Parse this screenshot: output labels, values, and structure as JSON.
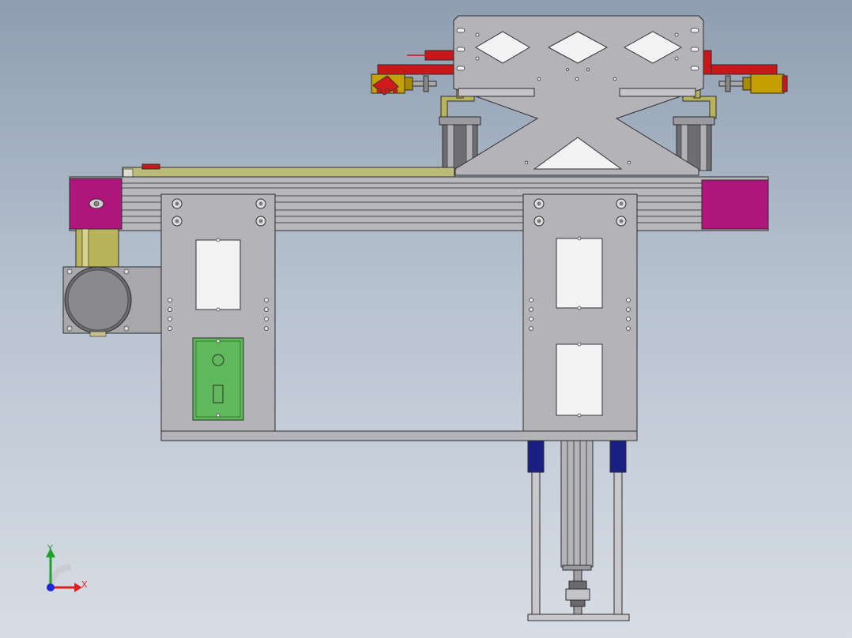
{
  "view": {
    "background_top": "#8e9db0",
    "background_bottom": "#d7dde6"
  },
  "triad": {
    "y_label": "Y",
    "x_label": "X",
    "y_color": "#1fa22a",
    "x_color": "#e02020",
    "z_color": "#1a2ad8"
  },
  "colors": {
    "steel": "#b4b4b8",
    "steel_dark": "#9a9aa0",
    "magenta": "#b0157c",
    "red": "#c8181c",
    "olive": "#b8b45a",
    "gold": "#c6a000",
    "green_panel": "#5fb85a",
    "navy": "#1a1f82",
    "motor_gray": "#8a8a8a"
  }
}
